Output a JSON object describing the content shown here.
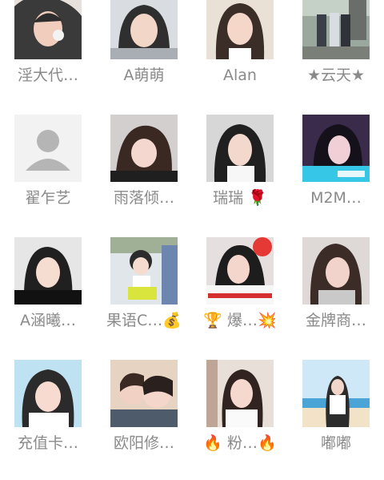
{
  "contacts": [
    {
      "name": "淫大代…",
      "avatar": "avatar-photo"
    },
    {
      "name": "A萌萌",
      "avatar": "avatar-photo"
    },
    {
      "name": "Alan",
      "avatar": "avatar-photo"
    },
    {
      "name": "★云天★",
      "avatar": "avatar-photo"
    },
    {
      "name": "翟乍艺",
      "avatar": "default-user-icon"
    },
    {
      "name": "雨落倾…",
      "avatar": "avatar-photo"
    },
    {
      "name": "瑞瑞 🌹",
      "avatar": "avatar-photo"
    },
    {
      "name": "M2M…",
      "avatar": "avatar-photo"
    },
    {
      "name": "A涵曦…",
      "avatar": "avatar-photo"
    },
    {
      "name": "果语C…💰",
      "avatar": "avatar-photo"
    },
    {
      "name": "🏆 爆…💥",
      "avatar": "avatar-photo"
    },
    {
      "name": "金牌商…",
      "avatar": "avatar-photo"
    },
    {
      "name": "充值卡…",
      "avatar": "avatar-photo"
    },
    {
      "name": "欧阳修…",
      "avatar": "avatar-photo"
    },
    {
      "name": "🔥 粉…🔥",
      "avatar": "avatar-photo"
    },
    {
      "name": "嘟嘟",
      "avatar": "avatar-photo"
    }
  ]
}
